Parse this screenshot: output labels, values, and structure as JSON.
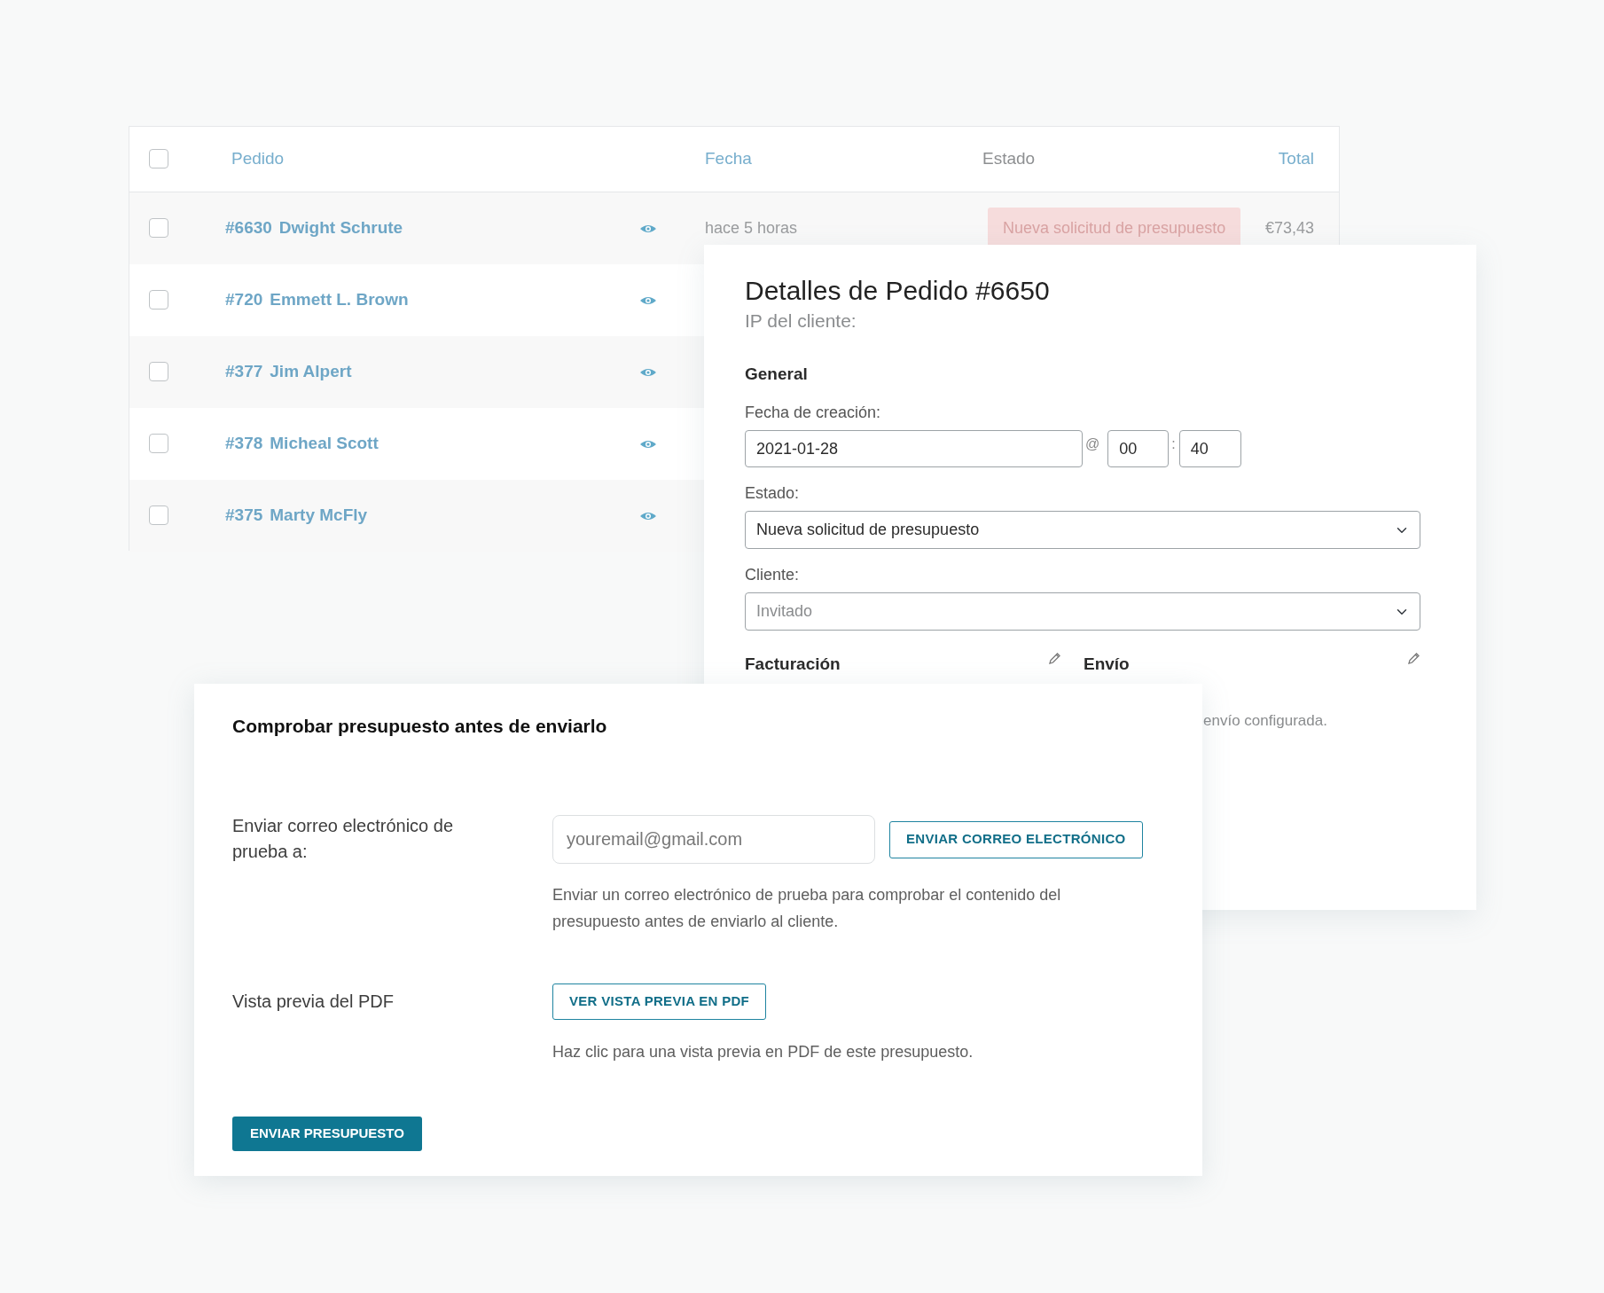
{
  "orders_table": {
    "select_all": {
      "checked": false
    },
    "columns": [
      {
        "label": "Pedido",
        "sortable": true
      },
      {
        "label": "Fecha",
        "sortable": true
      },
      {
        "label": "Estado",
        "sortable": false
      },
      {
        "label": "Total",
        "sortable": true
      }
    ],
    "rows": [
      {
        "checked": false,
        "number": "#6630",
        "customer": "Dwight Schrute",
        "date": "hace 5 horas",
        "status": "Nueva solicitud de presupuesto",
        "total": "€73,43"
      },
      {
        "checked": false,
        "number": "#720",
        "customer": "Emmett L. Brown"
      },
      {
        "checked": false,
        "number": "#377",
        "customer": "Jim Alpert"
      },
      {
        "checked": false,
        "number": "#378",
        "customer": "Micheal Scott"
      },
      {
        "checked": false,
        "number": "#375",
        "customer": "Marty McFly"
      }
    ]
  },
  "order_details": {
    "title": "Detalles de Pedido #6650",
    "subtitle": "IP del cliente:",
    "section": "General",
    "created_label": "Fecha de creación:",
    "date": "2021-01-28",
    "at": "@",
    "hour": "00",
    "separator": ":",
    "minute": "40",
    "status_label": "Estado:",
    "status_value": "Nueva solicitud de presupuesto",
    "customer_label": "Cliente:",
    "customer_placeholder": "Invitado",
    "billing_heading": "Facturación",
    "shipping_heading": "Envío",
    "shipping_note": "envío configurada."
  },
  "quote_check": {
    "title": "Comprobar presupuesto antes de enviarlo",
    "email_label": "Enviar correo electrónico de prueba a:",
    "email_placeholder": "youremail@gmail.com",
    "email_button": "ENVIAR CORREO ELECTRÓNICO",
    "email_help": "Enviar un correo electrónico de prueba para comprobar el contenido del presupuesto antes de enviarlo al cliente.",
    "pdf_label": "Vista previa del PDF",
    "pdf_button": "VER VISTA PREVIA EN PDF",
    "pdf_help": "Haz clic para una vista previa en PDF de este presupuesto.",
    "submit_button": "ENVIAR PRESUPUESTO"
  }
}
